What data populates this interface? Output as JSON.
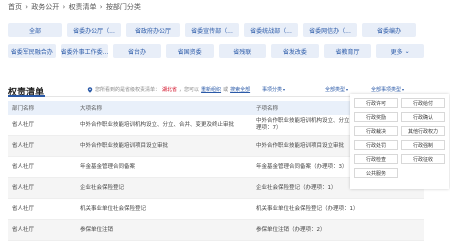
{
  "breadcrumb": [
    "首页",
    "政务公开",
    "权责清单",
    "按部门分类"
  ],
  "breadcrumb_sep": "›",
  "departments_row1": [
    "全部",
    "省委办公厅（...",
    "省政府办公厅",
    "省委宣传部（...",
    "省委统战部（...",
    "省委网信办（...",
    "省委编办"
  ],
  "departments_row2": [
    "省委军民融合办",
    "省委外事工作委...",
    "省台办",
    "省国资委",
    "省残联",
    "省发改委",
    "省教育厅",
    "更多"
  ],
  "more_caret": "⌄",
  "section_title": "权责清单",
  "hint": {
    "prefix": "您所看到的是省级权责清单：",
    "dept": "湖北省",
    "middle": "，您可以",
    "link1": "重新组织",
    "sep": "或",
    "link2": "搜索全部"
  },
  "filters": [
    "事项分类",
    "全部类型",
    "全部事项类型"
  ],
  "filter_caret": "▾",
  "table": {
    "headers": [
      "部门名称",
      "大项名称",
      "子项名称"
    ],
    "rows": [
      {
        "dept": "省人社厅",
        "item": "中外合作职业技能培训机构设立、分立、合并、变更及终止审批",
        "sub": "中外合作职业技能培训机构设立、分立、合并、变更及终止审批（办理项：7）"
      },
      {
        "dept": "省人社厅",
        "item": "中外合作职业技能培训项目设立审批",
        "sub": "中外合作职业技能培训项目设立审批"
      },
      {
        "dept": "省人社厅",
        "item": "年金基金管理合同备案",
        "sub": "年金基金管理合同备案（办理项：3）"
      },
      {
        "dept": "省人社厅",
        "item": "企业社会保险登记",
        "sub": "企业社会保险登记（办理项：1）"
      },
      {
        "dept": "省人社厅",
        "item": "机关事业单位社会保险登记",
        "sub": "机关事业单位社会保险登记（办理项：1）"
      },
      {
        "dept": "省人社厅",
        "item": "参保单位注销",
        "sub": "参保单位注销（办理项：2）"
      }
    ]
  },
  "popup_items": [
    "行政许可",
    "行政给付",
    "行政奖励",
    "行政确认",
    "行政裁决",
    "其他行政权力",
    "行政处罚",
    "行政强制",
    "行政检查",
    "行政征收",
    "公共服务"
  ]
}
